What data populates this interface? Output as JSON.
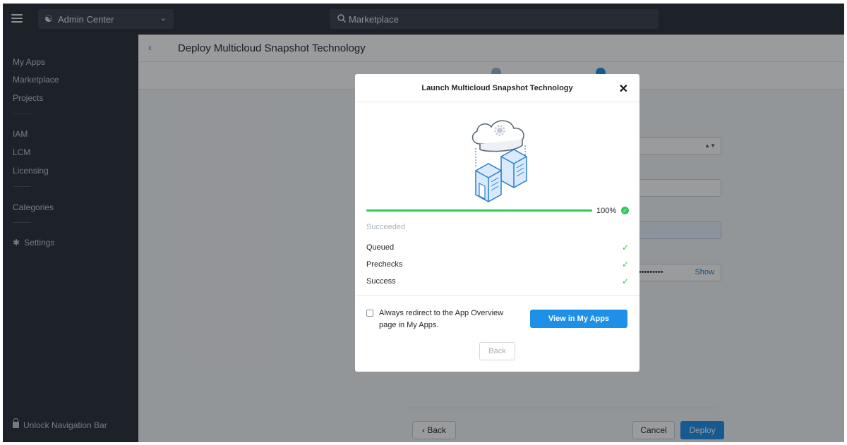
{
  "topbar": {
    "app_name": "Admin Center",
    "search_text": "Marketplace"
  },
  "sidebar": {
    "items": [
      {
        "label": "My Apps"
      },
      {
        "label": "Marketplace"
      },
      {
        "label": "Projects"
      },
      {
        "label": "IAM"
      },
      {
        "label": "LCM"
      },
      {
        "label": "Licensing"
      },
      {
        "label": "Categories"
      },
      {
        "label": "Settings"
      }
    ],
    "unlock_label": "Unlock Navigation Bar"
  },
  "page": {
    "title": "Deploy Multicloud Snapshot Technology",
    "password_mask": "••••••••••",
    "show_label": "Show",
    "back_label": "Back",
    "cancel_label": "Cancel",
    "deploy_label": "Deploy"
  },
  "modal": {
    "title": "Launch Multicloud Snapshot Technology",
    "progress_percent": 100,
    "progress_text": "100%",
    "status": "Succeeded",
    "steps": [
      {
        "label": "Queued"
      },
      {
        "label": "Prechecks"
      },
      {
        "label": "Success"
      }
    ],
    "checkbox_label": "Always redirect to the App Overview page in My Apps.",
    "view_button": "View in My Apps",
    "back_button": "Back"
  },
  "colors": {
    "sidebar_bg": "#2a3038",
    "accent": "#1e90e8",
    "success": "#34c759"
  }
}
